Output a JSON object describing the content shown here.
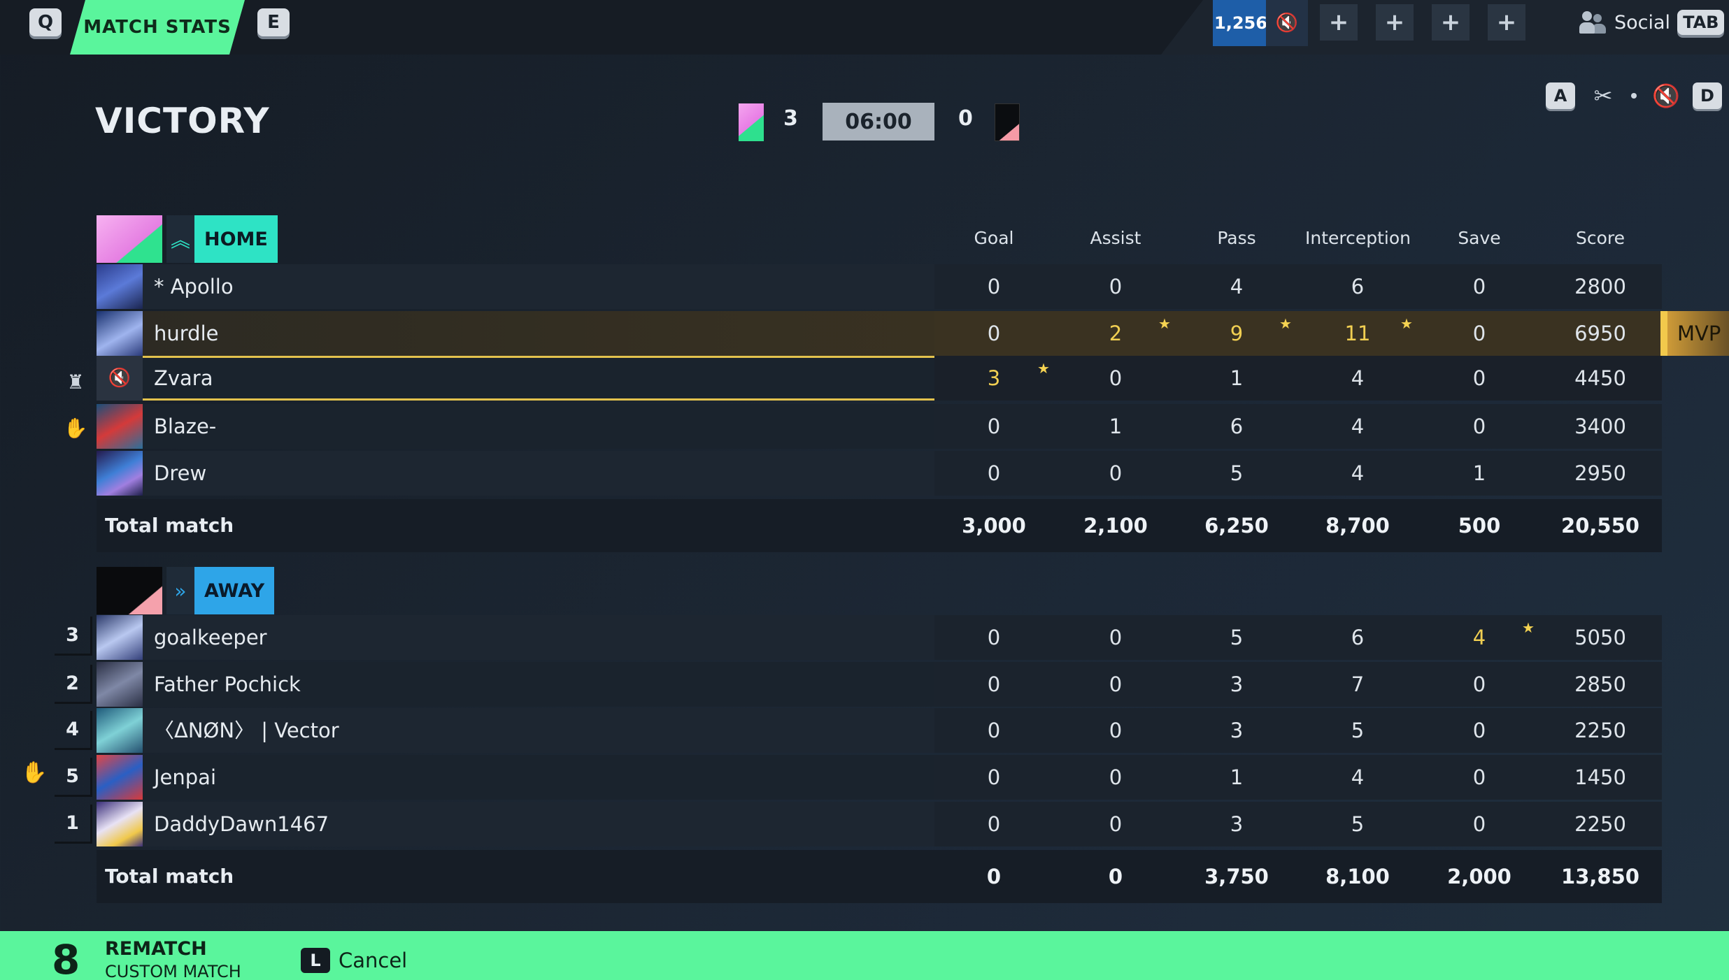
{
  "topbar": {
    "key_prev": "Q",
    "key_next": "E",
    "active_tab": "MATCH STATS",
    "currency": "1,256",
    "plus_symbol": "+",
    "social_label": "Social",
    "social_key": "TAB"
  },
  "header": {
    "result": "VICTORY",
    "home_score": "3",
    "timer": "06:00",
    "away_score": "0",
    "key_left": "A",
    "key_right": "D"
  },
  "columns": [
    "Goal",
    "Assist",
    "Pass",
    "Interception",
    "Save",
    "Score"
  ],
  "home": {
    "team_name": "HOME",
    "players": [
      {
        "name": "* Apollo",
        "goal": "0",
        "assist": "0",
        "pass": "4",
        "interception": "6",
        "save": "0",
        "score": "2800"
      },
      {
        "name": "hurdle",
        "goal": "0",
        "assist": "2",
        "pass": "9",
        "interception": "11",
        "save": "0",
        "score": "6950"
      },
      {
        "name": "Zvara",
        "goal": "3",
        "assist": "0",
        "pass": "1",
        "interception": "4",
        "save": "0",
        "score": "4450"
      },
      {
        "name": "Blaze-",
        "goal": "0",
        "assist": "1",
        "pass": "6",
        "interception": "4",
        "save": "0",
        "score": "3400"
      },
      {
        "name": "Drew",
        "goal": "0",
        "assist": "0",
        "pass": "5",
        "interception": "4",
        "save": "1",
        "score": "2950"
      }
    ],
    "total": {
      "label": "Total match",
      "goal": "3,000",
      "assist": "2,100",
      "pass": "6,250",
      "interception": "8,700",
      "save": "500",
      "score": "20,550"
    },
    "mvp_label": "MVP"
  },
  "away": {
    "team_name": "AWAY",
    "players": [
      {
        "rank": "3",
        "name": "goalkeeper",
        "goal": "0",
        "assist": "0",
        "pass": "5",
        "interception": "6",
        "save": "4",
        "score": "5050"
      },
      {
        "rank": "2",
        "name": "Father Pochick",
        "goal": "0",
        "assist": "0",
        "pass": "3",
        "interception": "7",
        "save": "0",
        "score": "2850"
      },
      {
        "rank": "4",
        "name": "〈ΔNØN〉 | Vector",
        "goal": "0",
        "assist": "0",
        "pass": "3",
        "interception": "5",
        "save": "0",
        "score": "2250"
      },
      {
        "rank": "5",
        "name": "Jenpai",
        "goal": "0",
        "assist": "0",
        "pass": "1",
        "interception": "4",
        "save": "0",
        "score": "1450"
      },
      {
        "rank": "1",
        "name": "DaddyDawn1467",
        "goal": "0",
        "assist": "0",
        "pass": "3",
        "interception": "5",
        "save": "0",
        "score": "2250"
      }
    ],
    "total": {
      "label": "Total match",
      "goal": "0",
      "assist": "0",
      "pass": "3,750",
      "interception": "8,100",
      "save": "2,000",
      "score": "13,850"
    }
  },
  "bottombar": {
    "count": "8",
    "title": "REMATCH",
    "subtitle": "CUSTOM MATCH",
    "cancel_key": "L",
    "cancel_label": "Cancel"
  },
  "colors": {
    "accent_green": "#5af59c",
    "home_teal": "#2ee3c5",
    "away_blue": "#2ea5e8",
    "highlight_gold": "#f1cf52"
  }
}
